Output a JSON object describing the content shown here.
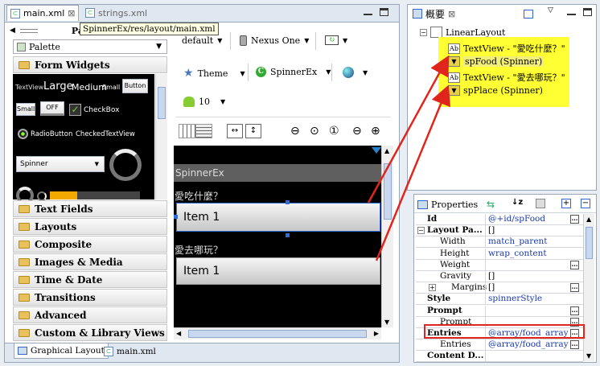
{
  "editor_tabs": [
    {
      "label": "main.xml",
      "active": true
    },
    {
      "label": "strings.xml",
      "active": false
    }
  ],
  "tooltip": "SpinnerEx/res/layout/main.xml",
  "palette": {
    "title": "Palette",
    "dropdown": "Palette",
    "open_category": "Form Widgets",
    "widgets": {
      "textview": "TextView",
      "large": "Large",
      "medium": "Medium",
      "small": "Small",
      "button": "Button",
      "small_btn": "Small",
      "off": "OFF",
      "checkbox": "CheckBox",
      "radio": "RadioButton",
      "checked_text": "CheckedTextView",
      "spinner": "Spinner"
    },
    "categories": [
      "Text Fields",
      "Layouts",
      "Composite",
      "Images & Media",
      "Time & Date",
      "Transitions",
      "Advanced",
      "Custom & Library Views"
    ]
  },
  "toolbar": {
    "config": "default",
    "device": "Nexus One",
    "theme": "Theme",
    "activity": "SpinnerEx",
    "api": "10"
  },
  "canvas": {
    "app_title": "SpinnerEx",
    "label1": "愛吃什麼？",
    "spinner1": "Item 1",
    "label2": "愛去哪玩？",
    "spinner2": "Item 1"
  },
  "bottom_tabs": [
    "Graphical Layout",
    "main.xml"
  ],
  "outline": {
    "title": "概要",
    "root": "LinearLayout",
    "items": [
      {
        "type": "Ab",
        "label": "TextView - \"愛吃什麼？\""
      },
      {
        "type": "sp",
        "label": "spFood (Spinner)"
      },
      {
        "type": "Ab",
        "label": "TextView - \"愛去哪玩？\""
      },
      {
        "type": "sp",
        "label": "spPlace (Spinner)"
      }
    ]
  },
  "properties": {
    "title": "Properties",
    "rows": [
      {
        "key": "Id",
        "value": "@+id/spFood",
        "bold": true
      },
      {
        "key": "Layout Pa...",
        "value": "[]",
        "bold": true
      },
      {
        "key": "Width",
        "value": "match_parent",
        "bold": false
      },
      {
        "key": "Height",
        "value": "wrap_content",
        "bold": false
      },
      {
        "key": "Weight",
        "value": "",
        "bold": false
      },
      {
        "key": "Gravity",
        "value": "[]",
        "bold": false
      },
      {
        "key": "Margins",
        "value": "[]",
        "bold": false
      },
      {
        "key": "Style",
        "value": "spinnerStyle",
        "bold": true
      },
      {
        "key": "Prompt",
        "value": "",
        "bold": true
      },
      {
        "key": "Prompt",
        "value": "",
        "bold": false
      },
      {
        "key": "Entries",
        "value": "@array/food_array",
        "bold": true
      },
      {
        "key": "Entries",
        "value": "@array/food_array",
        "bold": false
      },
      {
        "key": "Content D...",
        "value": "",
        "bold": true
      }
    ]
  },
  "colors": {
    "highlight": "#ffff33",
    "arrow": "#e0261c",
    "entries_box": "#e0261c"
  }
}
